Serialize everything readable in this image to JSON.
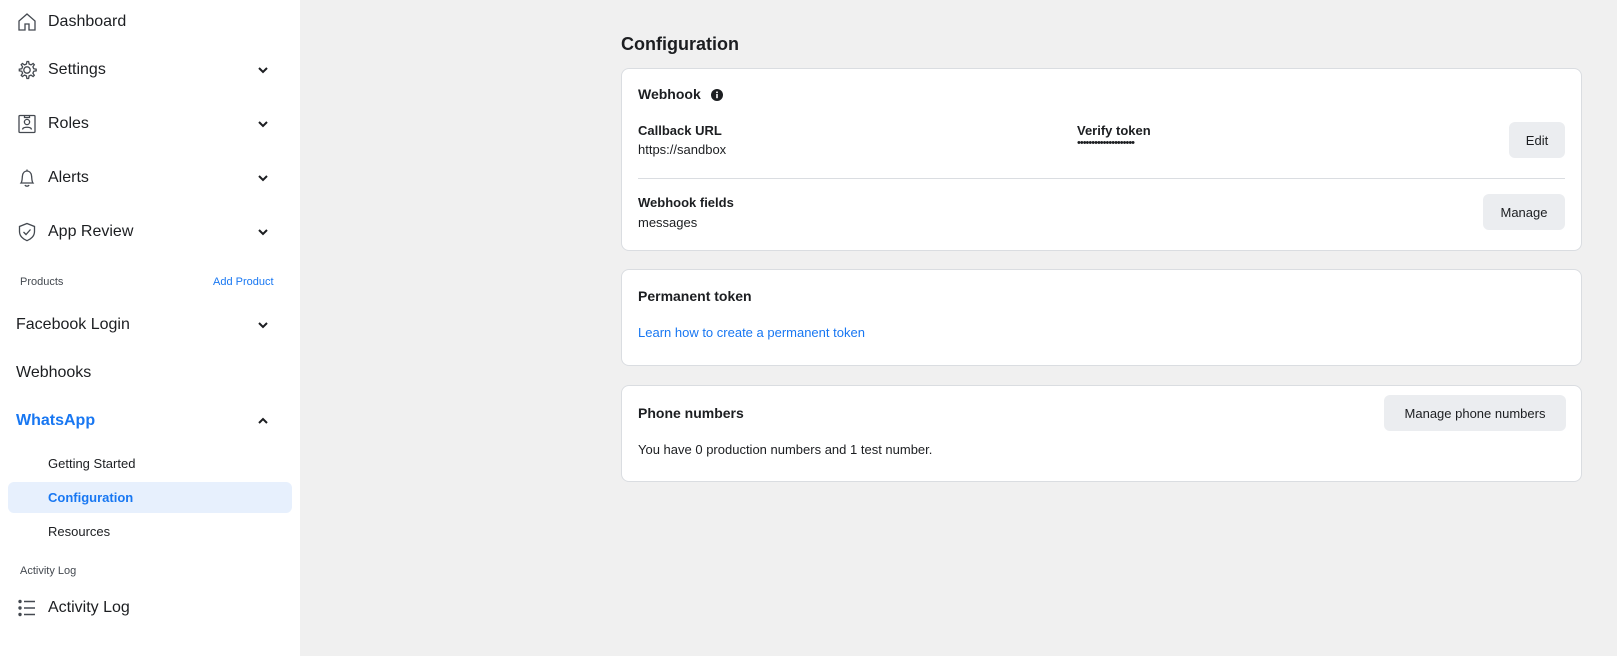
{
  "sidebar": {
    "items": [
      {
        "label": "Dashboard",
        "icon": "home-icon"
      },
      {
        "label": "Settings",
        "icon": "gear-icon"
      },
      {
        "label": "Roles",
        "icon": "id-card-icon"
      },
      {
        "label": "Alerts",
        "icon": "bell-icon"
      },
      {
        "label": "App Review",
        "icon": "shield-check-icon"
      }
    ],
    "products_label": "Products",
    "add_product": "Add Product",
    "products": [
      {
        "label": "Facebook Login"
      },
      {
        "label": "Webhooks"
      },
      {
        "label": "WhatsApp"
      }
    ],
    "whatsapp_sub": [
      {
        "label": "Getting Started"
      },
      {
        "label": "Configuration"
      },
      {
        "label": "Resources"
      }
    ],
    "activity_section_label": "Activity Log",
    "activity_item": {
      "label": "Activity Log",
      "icon": "list-icon"
    }
  },
  "main": {
    "title": "Configuration",
    "webhook": {
      "title": "Webhook",
      "callback_label": "Callback URL",
      "callback_value": "https://sandbox",
      "verify_label": "Verify token",
      "verify_value": "••••••••••••••••••••",
      "edit_button": "Edit",
      "fields_label": "Webhook fields",
      "fields_value": "messages",
      "manage_button": "Manage"
    },
    "permanent_token": {
      "title": "Permanent token",
      "link": "Learn how to create a permanent token"
    },
    "phone_numbers": {
      "title": "Phone numbers",
      "manage_button": "Manage phone numbers",
      "description": "You have 0 production numbers and 1 test number."
    }
  },
  "colors": {
    "accent": "#1877f2",
    "background": "#f0f0f0",
    "selected_bg": "#e7f0fd",
    "button_bg": "#ebedf0"
  }
}
